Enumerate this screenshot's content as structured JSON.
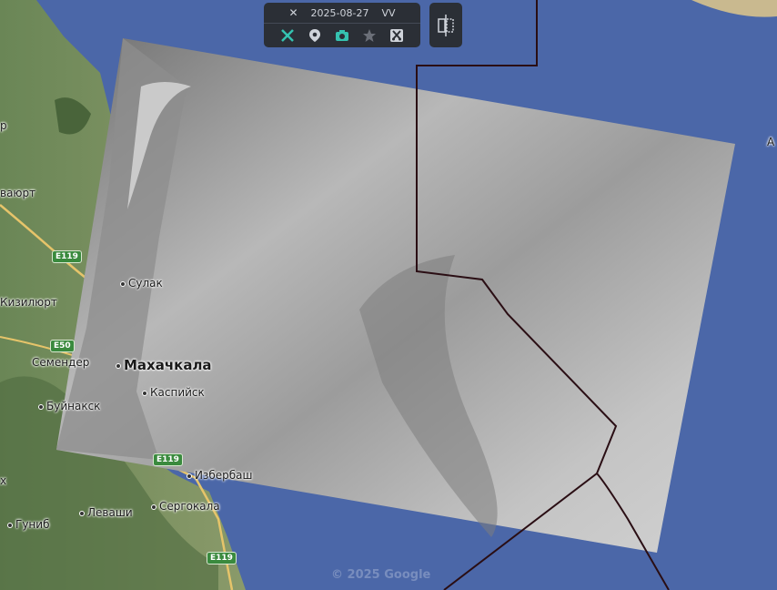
{
  "toolbar": {
    "date": "2025-08-27",
    "polarization": "VV",
    "buttons": [
      "satellite-icon",
      "pin-icon",
      "camera-icon",
      "star-icon",
      "cut-icon"
    ],
    "colors": {
      "accent": "#35c2b0",
      "inactive": "#6b6f78",
      "panel": "#2b2f36"
    }
  },
  "map": {
    "places": {
      "top_left": "р",
      "left_mid": "ваюрт",
      "sulak": "Сулак",
      "kizilyurt": "Кизилюрт",
      "makhachkala": "Махачкала",
      "semender": "Семендер",
      "kaspiysk": "Каспийск",
      "buynaksk": "Буйнакск",
      "izberbash": "Избербаш",
      "sergokala": "Сергокала",
      "levashi": "Леваши",
      "gunib": "Гуниб",
      "edge_right": "А",
      "edge_left": "х"
    },
    "roads": {
      "e119": "E119",
      "e50": "E50"
    },
    "copyright": "© 2025 Google",
    "colors": {
      "sea": "#4b67a8",
      "land": "#5e7a4c",
      "border": "#2a0e14"
    }
  }
}
